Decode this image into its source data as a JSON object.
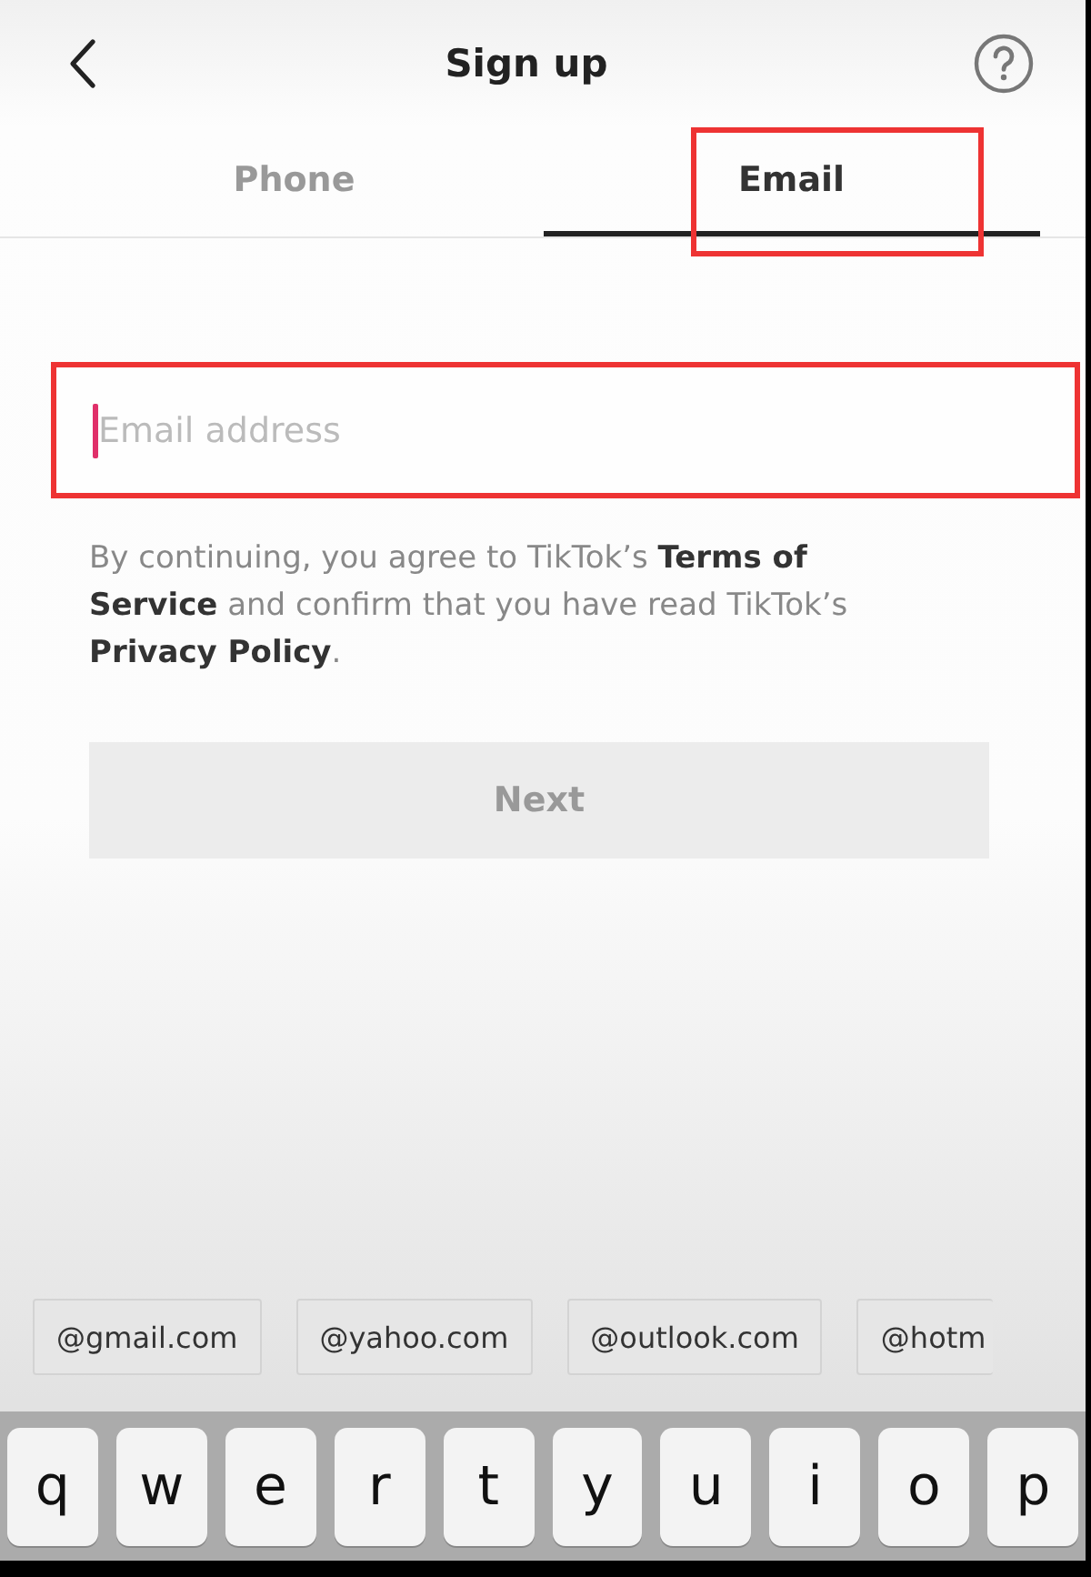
{
  "header": {
    "title": "Sign up"
  },
  "tabs": [
    {
      "label": "Phone",
      "selected": false,
      "highlighted": false
    },
    {
      "label": "Email",
      "selected": true,
      "highlighted": true
    }
  ],
  "email_field": {
    "placeholder": "Email address",
    "focused": true,
    "highlighted": true
  },
  "legal_text": "By continuing, you agree to TikTok’s **Terms of Service** and confirm that you have read TikTok’s **Privacy Policy**.",
  "next_button": {
    "label": "Next",
    "disabled": true
  },
  "suggestions": [
    "@gmail.com",
    "@yahoo.com",
    "@outlook.com",
    "@hotm"
  ],
  "keyboard": {
    "keys": [
      "q",
      "w",
      "e",
      "r",
      "t",
      "y",
      "u",
      "i",
      "o",
      "p"
    ]
  }
}
